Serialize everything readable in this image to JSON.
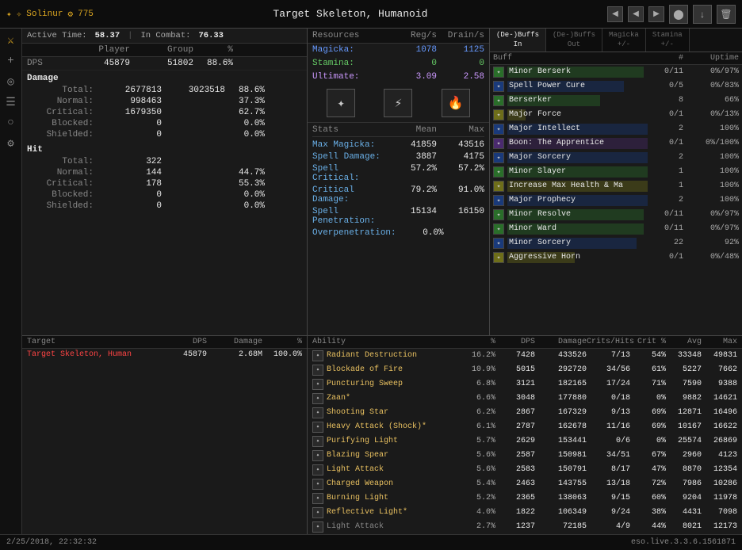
{
  "topbar": {
    "char_icon": "✦",
    "char_name": "Solinur",
    "char_level_icon": "⚙",
    "char_level": "775",
    "title": "Target Skeleton, Humanoid",
    "nav_prev": "◀",
    "nav_prev2": "◀",
    "nav_next": "▶",
    "nav_record": "⬤",
    "nav_save": "⬇",
    "nav_delete": "🗑"
  },
  "sidebar": {
    "icons": [
      "⚔",
      "+",
      "⚙",
      "☰",
      "◎",
      "⚙"
    ]
  },
  "activetime": {
    "label": "Active Time:",
    "value": "58.37",
    "combat_label": "In Combat:",
    "combat_value": "76.33"
  },
  "dps_table": {
    "headers": [
      "DPS",
      "Player",
      "Group",
      "%"
    ],
    "row": [
      "DPS",
      "45879",
      "51802",
      "88.6%"
    ]
  },
  "damage": {
    "header": "Damage",
    "rows": [
      {
        "label": "Total:",
        "v1": "2677813",
        "v2": "3023518",
        "v3": "88.6%"
      },
      {
        "label": "Normal:",
        "v1": "998463",
        "v2": "",
        "v3": "37.3%"
      },
      {
        "label": "Critical:",
        "v1": "1679350",
        "v2": "",
        "v3": "62.7%"
      },
      {
        "label": "Blocked:",
        "v1": "0",
        "v2": "",
        "v3": "0.0%"
      },
      {
        "label": "Shielded:",
        "v1": "0",
        "v2": "",
        "v3": "0.0%"
      }
    ]
  },
  "hit": {
    "header": "Hit",
    "rows": [
      {
        "label": "Total:",
        "v1": "322",
        "v2": "",
        "v3": ""
      },
      {
        "label": "Normal:",
        "v1": "144",
        "v2": "",
        "v3": "44.7%"
      },
      {
        "label": "Critical:",
        "v1": "178",
        "v2": "",
        "v3": "55.3%"
      },
      {
        "label": "Blocked:",
        "v1": "0",
        "v2": "",
        "v3": "0.0%"
      },
      {
        "label": "Shielded:",
        "v1": "0",
        "v2": "",
        "v3": "0.0%"
      }
    ]
  },
  "resources": {
    "header": "Resources",
    "reg_header": "Reg/s",
    "drain_header": "Drain/s",
    "rows": [
      {
        "name": "Magicka:",
        "val": "1078",
        "drain": "1125",
        "color": "magicka"
      },
      {
        "name": "Stamina:",
        "val": "0",
        "drain": "0",
        "color": "stamina"
      },
      {
        "name": "Ultimate:",
        "val": "3.09",
        "drain": "2.58",
        "color": "ultimate"
      }
    ]
  },
  "stats": {
    "header": "Stats",
    "mean_header": "Mean",
    "max_header": "Max",
    "rows": [
      {
        "name": "Max Magicka:",
        "mean": "41859",
        "max": "43516"
      },
      {
        "name": "Spell Damage:",
        "mean": "3887",
        "max": "4175"
      },
      {
        "name": "Spell Critical:",
        "mean": "57.2%",
        "max": "57.2%"
      },
      {
        "name": "Critical Damage:",
        "mean": "79.2%",
        "max": "91.0%"
      },
      {
        "name": "Spell Penetration:",
        "mean": "15134",
        "max": "16150"
      },
      {
        "name": "Overpenetration:",
        "mean": "0.0%",
        "max": ""
      }
    ]
  },
  "buffs": {
    "tabs": [
      {
        "label": "(De-)Buffs\nIn",
        "active": true
      },
      {
        "label": "(De-)Buffs\nOut",
        "active": false
      },
      {
        "label": "Magicka\n+/-",
        "active": false
      },
      {
        "label": "Stamina\n+/-",
        "active": false
      }
    ],
    "headers": [
      "Buff",
      "#",
      "Uptime"
    ],
    "rows": [
      {
        "name": "Minor Berserk",
        "num": "0/11",
        "uptime": "0%/97%",
        "bar_pct": 97,
        "bar_color": "green-bar"
      },
      {
        "name": "Spell Power Cure",
        "num": "0/5",
        "uptime": "0%/83%",
        "bar_pct": 83,
        "bar_color": "blue-bar"
      },
      {
        "name": "Berserker",
        "num": "8",
        "uptime": "66%",
        "bar_pct": 66,
        "bar_color": "green-bar"
      },
      {
        "name": "Major Force",
        "num": "0/1",
        "uptime": "0%/13%",
        "bar_pct": 13,
        "bar_color": "yellow-bar"
      },
      {
        "name": "Major Intellect",
        "num": "2",
        "uptime": "100%",
        "bar_pct": 100,
        "bar_color": "blue-bar"
      },
      {
        "name": "Boon: The Apprentice",
        "num": "0/1",
        "uptime": "0%/100%",
        "bar_pct": 100,
        "bar_color": "purple-bar"
      },
      {
        "name": "Major Sorcery",
        "num": "2",
        "uptime": "100%",
        "bar_pct": 100,
        "bar_color": "blue-bar"
      },
      {
        "name": "Minor Slayer",
        "num": "1",
        "uptime": "100%",
        "bar_pct": 100,
        "bar_color": "green-bar"
      },
      {
        "name": "Increase Max Health & Ma",
        "num": "1",
        "uptime": "100%",
        "bar_pct": 100,
        "bar_color": "yellow-bar"
      },
      {
        "name": "Major Prophecy",
        "num": "2",
        "uptime": "100%",
        "bar_pct": 100,
        "bar_color": "blue-bar"
      },
      {
        "name": "Minor Resolve",
        "num": "0/11",
        "uptime": "0%/97%",
        "bar_pct": 97,
        "bar_color": "green-bar"
      },
      {
        "name": "Minor Ward",
        "num": "0/11",
        "uptime": "0%/97%",
        "bar_pct": 97,
        "bar_color": "green-bar"
      },
      {
        "name": "Minor Sorcery",
        "num": "22",
        "uptime": "92%",
        "bar_pct": 92,
        "bar_color": "blue-bar"
      },
      {
        "name": "Aggressive Horn",
        "num": "0/1",
        "uptime": "0%/48%",
        "bar_pct": 48,
        "bar_color": "yellow-bar"
      }
    ]
  },
  "targets": {
    "headers": [
      "Target",
      "DPS",
      "Damage",
      "%"
    ],
    "rows": [
      {
        "name": "Target Skeleton, Human",
        "dps": "45879",
        "damage": "2.68M",
        "pct": "100.0%"
      }
    ]
  },
  "abilities": {
    "headers": [
      "Ability",
      "%",
      "DPS",
      "Damage",
      "Crits/Hits",
      "Crit %",
      "Avg",
      "Max"
    ],
    "rows": [
      {
        "name": "Radiant Destruction",
        "pct": "16.2%",
        "dps": "7428",
        "damage": "433526",
        "crits": "7/13",
        "critpct": "54%",
        "avg": "33348",
        "max": "49831",
        "color": "orange"
      },
      {
        "name": "Blockade of Fire",
        "pct": "10.9%",
        "dps": "5015",
        "damage": "292720",
        "crits": "34/56",
        "critpct": "61%",
        "avg": "5227",
        "max": "7662",
        "color": "orange"
      },
      {
        "name": "Puncturing Sweep",
        "pct": "6.8%",
        "dps": "3121",
        "damage": "182165",
        "crits": "17/24",
        "critpct": "71%",
        "avg": "7590",
        "max": "9388",
        "color": "orange"
      },
      {
        "name": "Zaan*",
        "pct": "6.6%",
        "dps": "3048",
        "damage": "177880",
        "crits": "0/18",
        "critpct": "0%",
        "avg": "9882",
        "max": "14621",
        "color": "orange"
      },
      {
        "name": "Shooting Star",
        "pct": "6.2%",
        "dps": "2867",
        "damage": "167329",
        "crits": "9/13",
        "critpct": "69%",
        "avg": "12871",
        "max": "16496",
        "color": "orange"
      },
      {
        "name": "Heavy Attack (Shock)*",
        "pct": "6.1%",
        "dps": "2787",
        "damage": "162678",
        "crits": "11/16",
        "critpct": "69%",
        "avg": "10167",
        "max": "16622",
        "color": "orange"
      },
      {
        "name": "Purifying Light",
        "pct": "5.7%",
        "dps": "2629",
        "damage": "153441",
        "crits": "0/6",
        "critpct": "0%",
        "avg": "25574",
        "max": "26869",
        "color": "orange"
      },
      {
        "name": "Blazing Spear",
        "pct": "5.6%",
        "dps": "2587",
        "damage": "150981",
        "crits": "34/51",
        "critpct": "67%",
        "avg": "2960",
        "max": "4123",
        "color": "orange"
      },
      {
        "name": "Light Attack",
        "pct": "5.6%",
        "dps": "2583",
        "damage": "150791",
        "crits": "8/17",
        "critpct": "47%",
        "avg": "8870",
        "max": "12354",
        "color": "orange"
      },
      {
        "name": "Charged Weapon",
        "pct": "5.4%",
        "dps": "2463",
        "damage": "143755",
        "crits": "13/18",
        "critpct": "72%",
        "avg": "7986",
        "max": "10286",
        "color": "orange"
      },
      {
        "name": "Burning Light",
        "pct": "5.2%",
        "dps": "2365",
        "damage": "138063",
        "crits": "9/15",
        "critpct": "60%",
        "avg": "9204",
        "max": "11978",
        "color": "orange"
      },
      {
        "name": "Reflective Light*",
        "pct": "4.0%",
        "dps": "1822",
        "damage": "106349",
        "crits": "9/24",
        "critpct": "38%",
        "avg": "4431",
        "max": "7098",
        "color": "orange"
      },
      {
        "name": "Light Attack",
        "pct": "2.7%",
        "dps": "1237",
        "damage": "72185",
        "crits": "4/9",
        "critpct": "44%",
        "avg": "8021",
        "max": "12173",
        "color": "gray"
      }
    ]
  },
  "footer": {
    "timestamp": "2/25/2018, 22:32:32",
    "version": "eso.live.3.3.6.1561871"
  }
}
